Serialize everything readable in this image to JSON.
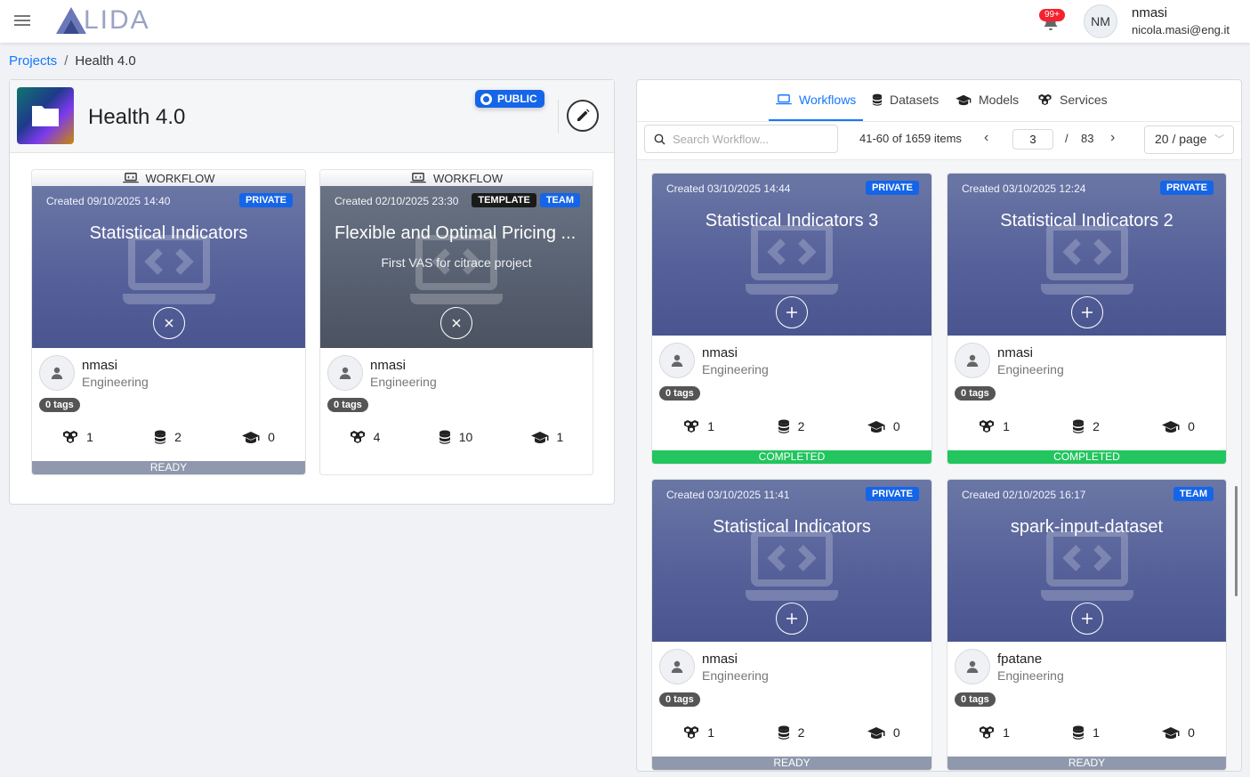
{
  "header": {
    "logo_text": "LIDA",
    "notifications_badge": "99+",
    "avatar_initials": "NM",
    "user_name": "nmasi",
    "user_email": "nicola.masi@eng.it"
  },
  "breadcrumb": {
    "root": "Projects",
    "separator": "/",
    "current": "Health 4.0"
  },
  "project": {
    "title": "Health 4.0",
    "visibility": "PUBLIC"
  },
  "project_cards": [
    {
      "kind": "WORKFLOW",
      "created": "Created 09/10/2025 14:40",
      "badges": [
        "PRIVATE"
      ],
      "title": "Statistical Indicators",
      "subtitle": "",
      "owner": "nmasi",
      "org": "Engineering",
      "tags": "0 tags",
      "services": "1",
      "datasets": "2",
      "models": "0",
      "status": "READY"
    },
    {
      "kind": "WORKFLOW",
      "created": "Created 02/10/2025 23:30",
      "badges": [
        "TEMPLATE",
        "TEAM"
      ],
      "title": "Flexible and Optimal Pricing ...",
      "subtitle": "First VAS for citrace project",
      "owner": "nmasi",
      "org": "Engineering",
      "tags": "0 tags",
      "services": "4",
      "datasets": "10",
      "models": "1",
      "status": ""
    }
  ],
  "tabs": [
    {
      "label": "Workflows",
      "icon": "laptop-code-icon",
      "active": true
    },
    {
      "label": "Datasets",
      "icon": "database-icon"
    },
    {
      "label": "Models",
      "icon": "graduation-cap-icon"
    },
    {
      "label": "Services",
      "icon": "cubes-icon"
    }
  ],
  "toolbar": {
    "search_placeholder": "Search Workflow...",
    "items_info": "41-60 of 1659 items",
    "page": "3",
    "separator": "/",
    "total_pages": "83",
    "page_size": "20 / page"
  },
  "workflow_cards": [
    {
      "created": "Created 03/10/2025 14:44",
      "badge": "PRIVATE",
      "title": "Statistical Indicators 3",
      "owner": "nmasi",
      "org": "Engineering",
      "tags": "0 tags",
      "services": "1",
      "datasets": "2",
      "models": "0",
      "status": "COMPLETED"
    },
    {
      "created": "Created 03/10/2025 12:24",
      "badge": "PRIVATE",
      "title": "Statistical Indicators 2",
      "owner": "nmasi",
      "org": "Engineering",
      "tags": "0 tags",
      "services": "1",
      "datasets": "2",
      "models": "0",
      "status": "COMPLETED"
    },
    {
      "created": "Created 03/10/2025 11:41",
      "badge": "PRIVATE",
      "title": "Statistical Indicators",
      "owner": "nmasi",
      "org": "Engineering",
      "tags": "0 tags",
      "services": "1",
      "datasets": "2",
      "models": "0",
      "status": "READY"
    },
    {
      "created": "Created 02/10/2025 16:17",
      "badge": "TEAM",
      "title": "spark-input-dataset",
      "owner": "fpatane",
      "org": "Engineering",
      "tags": "0 tags",
      "services": "1",
      "datasets": "1",
      "models": "0",
      "status": "READY"
    }
  ],
  "colors": {
    "accent": "#1677ff",
    "badge_blue": "#1565e8",
    "banner": "#56619a",
    "completed": "#22c55e",
    "ready": "#8f98ad"
  }
}
